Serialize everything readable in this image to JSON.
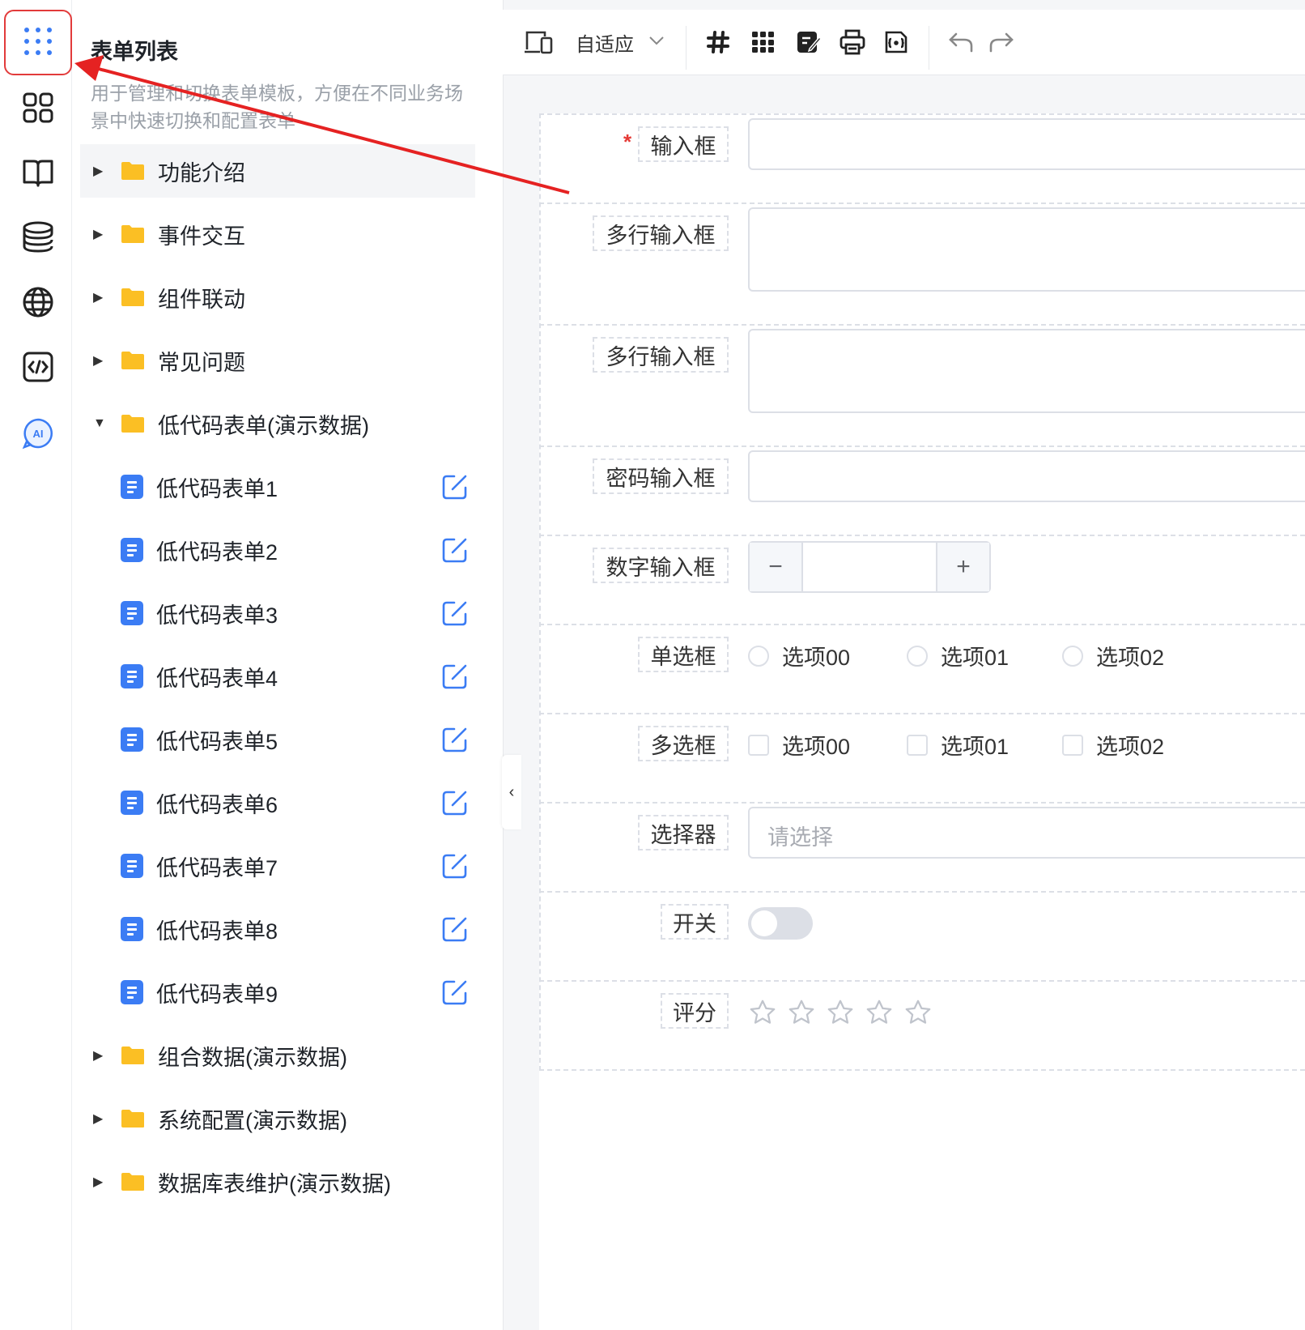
{
  "panel": {
    "title": "表单列表",
    "description": "用于管理和切换表单模板，方便在不同业务场景中快速切换和配置表单"
  },
  "tree": {
    "folders_top": [
      "功能介绍",
      "事件交互",
      "组件联动",
      "常见问题"
    ],
    "expanded_folder": "低代码表单(演示数据)",
    "leaves": [
      "低代码表单1",
      "低代码表单2",
      "低代码表单3",
      "低代码表单4",
      "低代码表单5",
      "低代码表单6",
      "低代码表单7",
      "低代码表单8",
      "低代码表单9"
    ],
    "folders_bottom": [
      "组合数据(演示数据)",
      "系统配置(演示数据)",
      "数据库表维护(演示数据)"
    ]
  },
  "toolbar": {
    "layout_mode": "自适应"
  },
  "form": {
    "input_label": "输入框",
    "textarea1_label": "多行输入框",
    "textarea2_label": "多行输入框",
    "password_label": "密码输入框",
    "number_label": "数字输入框",
    "number_minus": "−",
    "number_plus": "+",
    "radio_label": "单选框",
    "radio_options": [
      "选项00",
      "选项01",
      "选项02"
    ],
    "checkbox_label": "多选框",
    "checkbox_options": [
      "选项00",
      "选项01",
      "选项02"
    ],
    "select_label": "选择器",
    "select_placeholder": "请选择",
    "switch_label": "开关",
    "rate_label": "评分",
    "rate_value": 0,
    "rate_max": 5,
    "required_mark": "*"
  },
  "colors": {
    "accent": "#3b7cf4",
    "folder": "#fbbf24",
    "annotation": "#e23b3b"
  }
}
